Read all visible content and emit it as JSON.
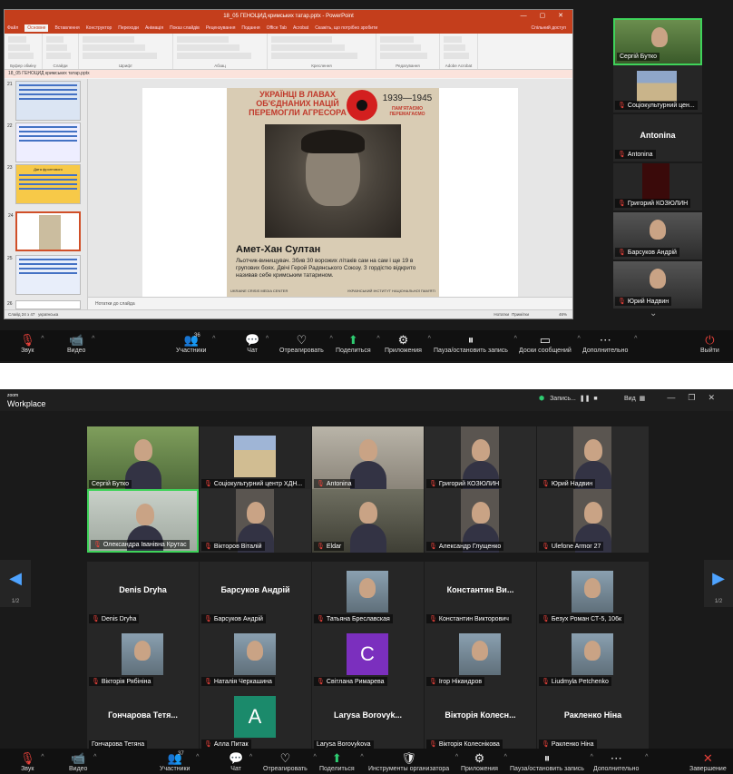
{
  "top": {
    "ppt": {
      "window_title": "18_05 ГЕНОЦИД кримських татар.pptx - PowerPoint",
      "menu": [
        "Файл",
        "Основне",
        "Вставлення",
        "Конструктор",
        "Переходи",
        "Анімація",
        "Показ слайдів",
        "Рецензування",
        "Подання",
        "Office Tab",
        "Acrobat"
      ],
      "active_menu": "Основне",
      "search_hint": "Скажіть, що потрібно зробити",
      "share": "Спільний доступ",
      "tabbar": "18_05 ГЕНОЦИД кримських татар.pptx",
      "ribbon_groups": [
        "Буфер обміну",
        "Слайди",
        "Шрифт",
        "Абзац",
        "Креслення",
        "Редагування",
        "Adobe Acrobat"
      ],
      "thumb_numbers": [
        "21",
        "22",
        "23",
        "24",
        "25",
        "26"
      ],
      "thumb_23_title": "Дата фронтового",
      "poster": {
        "headline": "УКРАЇНЦІ В ЛАВАХ ОБ'ЄДНАНИХ НАЦІЙ ПЕРЕМОГЛИ АГРЕСОРА",
        "years": "1939—1945",
        "memorial": "ПАМ'ЯТАЄМО ПЕРЕМАГАЄМО",
        "name": "Амет-Хан Султан",
        "text": "Льотчик-винищувач. Збив 30 ворожих літаків сам на сам і ще 19 в групових боях. Двічі Герой Радянського Союзу. З гордістю відкрито називав себе кримським татарином.",
        "footer_left": "UKRAINE CRISIS MEDIA CENTER",
        "footer_right": "УКРАЇНСЬКИЙ ІНСТИТУТ НАЦІОНАЛЬНОЇ ПАМ'ЯТІ"
      },
      "notes": "Нотатки до слайда",
      "status": "Слайд 24 з 47",
      "status_lang": "українська",
      "status_right": [
        "Нотатки",
        "Примітки"
      ],
      "zoom": "46%"
    },
    "strip": [
      {
        "name": "Сергій Бутко",
        "active": true,
        "muted": false,
        "kind": "video"
      },
      {
        "name": "Соціокультурний цен...",
        "muted": true,
        "kind": "image"
      },
      {
        "name": "Antonina",
        "muted": true,
        "kind": "name",
        "big": "Antonina"
      },
      {
        "name": "Григорий КОЗЮЛИН",
        "muted": true,
        "kind": "dark"
      },
      {
        "name": "Барсуков Андрій",
        "muted": true,
        "kind": "video"
      },
      {
        "name": "Юрий Надвин",
        "muted": true,
        "kind": "video"
      }
    ],
    "toolbar": [
      {
        "label": "Звук",
        "icon": "microphone-muted-icon",
        "glyph": "🎙",
        "red": true
      },
      {
        "label": "Видео",
        "icon": "video-off-icon",
        "glyph": "📹",
        "red": true
      },
      {
        "label": "Участники",
        "icon": "participants-icon",
        "glyph": "👥",
        "count": "36"
      },
      {
        "label": "Чат",
        "icon": "chat-icon",
        "glyph": "💬"
      },
      {
        "label": "Отреагировать",
        "icon": "heart-icon",
        "glyph": "♡"
      },
      {
        "label": "Поделиться",
        "icon": "share-icon",
        "glyph": "⬆",
        "green": true
      },
      {
        "label": "Приложения",
        "icon": "apps-icon",
        "glyph": "⚙"
      },
      {
        "label": "Пауза/остановить запись",
        "icon": "record-icon",
        "glyph": "⏸"
      },
      {
        "label": "Доски сообщений",
        "icon": "whiteboard-icon",
        "glyph": "▭"
      },
      {
        "label": "Дополнительно",
        "icon": "more-icon",
        "glyph": "⋯"
      },
      {
        "label": "Выйти",
        "icon": "leave-icon",
        "glyph": "⏻",
        "red": true
      }
    ]
  },
  "bottom": {
    "logo_small": "zoom",
    "logo": "Workplace",
    "rec": "Запись...",
    "view": "Вид",
    "page": "1/2",
    "grid": [
      {
        "name": "Сергій Бутко",
        "kind": "video",
        "muted": false
      },
      {
        "name": "Соціокультурний центр ХДН...",
        "kind": "image",
        "muted": true
      },
      {
        "name": "Antonina",
        "kind": "video",
        "muted": true
      },
      {
        "name": "Григорий КОЗЮЛИН",
        "kind": "video",
        "muted": true
      },
      {
        "name": "Юрий Надвин",
        "kind": "video",
        "muted": true
      },
      {
        "name": "Олександра Іванівна Крутас",
        "kind": "video",
        "muted": true,
        "active": true
      },
      {
        "name": "Вікторов Віталій",
        "kind": "video",
        "muted": true
      },
      {
        "name": "Eldar",
        "kind": "video",
        "muted": true
      },
      {
        "name": "Александр Глущенко",
        "kind": "video",
        "muted": true
      },
      {
        "name": "Ulefone Armor 27",
        "kind": "video",
        "muted": true
      },
      {
        "name": "Denis Dryha",
        "kind": "name",
        "big": "Denis Dryha",
        "muted": true
      },
      {
        "name": "Барсуков Андрій",
        "kind": "name",
        "big": "Барсуков Андрій",
        "muted": true
      },
      {
        "name": "Татьяна Бреславская",
        "kind": "photo",
        "muted": true
      },
      {
        "name": "Константин Викторович",
        "kind": "name",
        "big": "Константин Ви...",
        "muted": true
      },
      {
        "name": "Безух Роман СТ-5, 106к",
        "kind": "photo",
        "muted": true
      },
      {
        "name": "Вікторія Рябініна",
        "kind": "photo",
        "muted": true
      },
      {
        "name": "Наталія Черкашина",
        "kind": "photo",
        "muted": true
      },
      {
        "name": "Світлана Римарева",
        "kind": "letter",
        "letter": "C",
        "color": "#7b2fbe",
        "muted": true
      },
      {
        "name": "Ігор Нікандров",
        "kind": "photo",
        "muted": true
      },
      {
        "name": "Liudmyla Petchenko",
        "kind": "photo",
        "muted": true
      },
      {
        "name": "Гончарова Тетяна",
        "kind": "name",
        "big": "Гончарова Тетя...",
        "muted": false
      },
      {
        "name": "Алла Питак",
        "kind": "letter",
        "letter": "A",
        "color": "#1b8a6b",
        "muted": true
      },
      {
        "name": "Larysa Borovykova",
        "kind": "name",
        "big": "Larysa Borovyk...",
        "muted": false
      },
      {
        "name": "Вікторія Колеснікова",
        "kind": "name",
        "big": "Вікторія Колесн...",
        "muted": true
      },
      {
        "name": "Ракленко Ніна",
        "kind": "name",
        "big": "Ракленко Ніна",
        "muted": true
      }
    ],
    "toolbar": [
      {
        "label": "Звук",
        "icon": "microphone-muted-icon",
        "glyph": "🎙",
        "red": true
      },
      {
        "label": "Видео",
        "icon": "video-off-icon",
        "glyph": "📹",
        "red": true
      },
      {
        "label": "Участники",
        "icon": "participants-icon",
        "glyph": "👥",
        "count": "37"
      },
      {
        "label": "Чат",
        "icon": "chat-icon",
        "glyph": "💬"
      },
      {
        "label": "Отреагировать",
        "icon": "heart-icon",
        "glyph": "♡"
      },
      {
        "label": "Поделиться",
        "icon": "share-icon",
        "glyph": "⬆",
        "green": true
      },
      {
        "label": "Инструменты организатора",
        "icon": "host-tools-icon",
        "glyph": "🛡"
      },
      {
        "label": "Приложения",
        "icon": "apps-icon",
        "glyph": "⚙"
      },
      {
        "label": "Пауза/остановить запись",
        "icon": "record-icon",
        "glyph": "⏸"
      },
      {
        "label": "Дополнительно",
        "icon": "more-icon",
        "glyph": "⋯"
      },
      {
        "label": "Завершение",
        "icon": "end-icon",
        "glyph": "✕",
        "red": true
      }
    ]
  }
}
